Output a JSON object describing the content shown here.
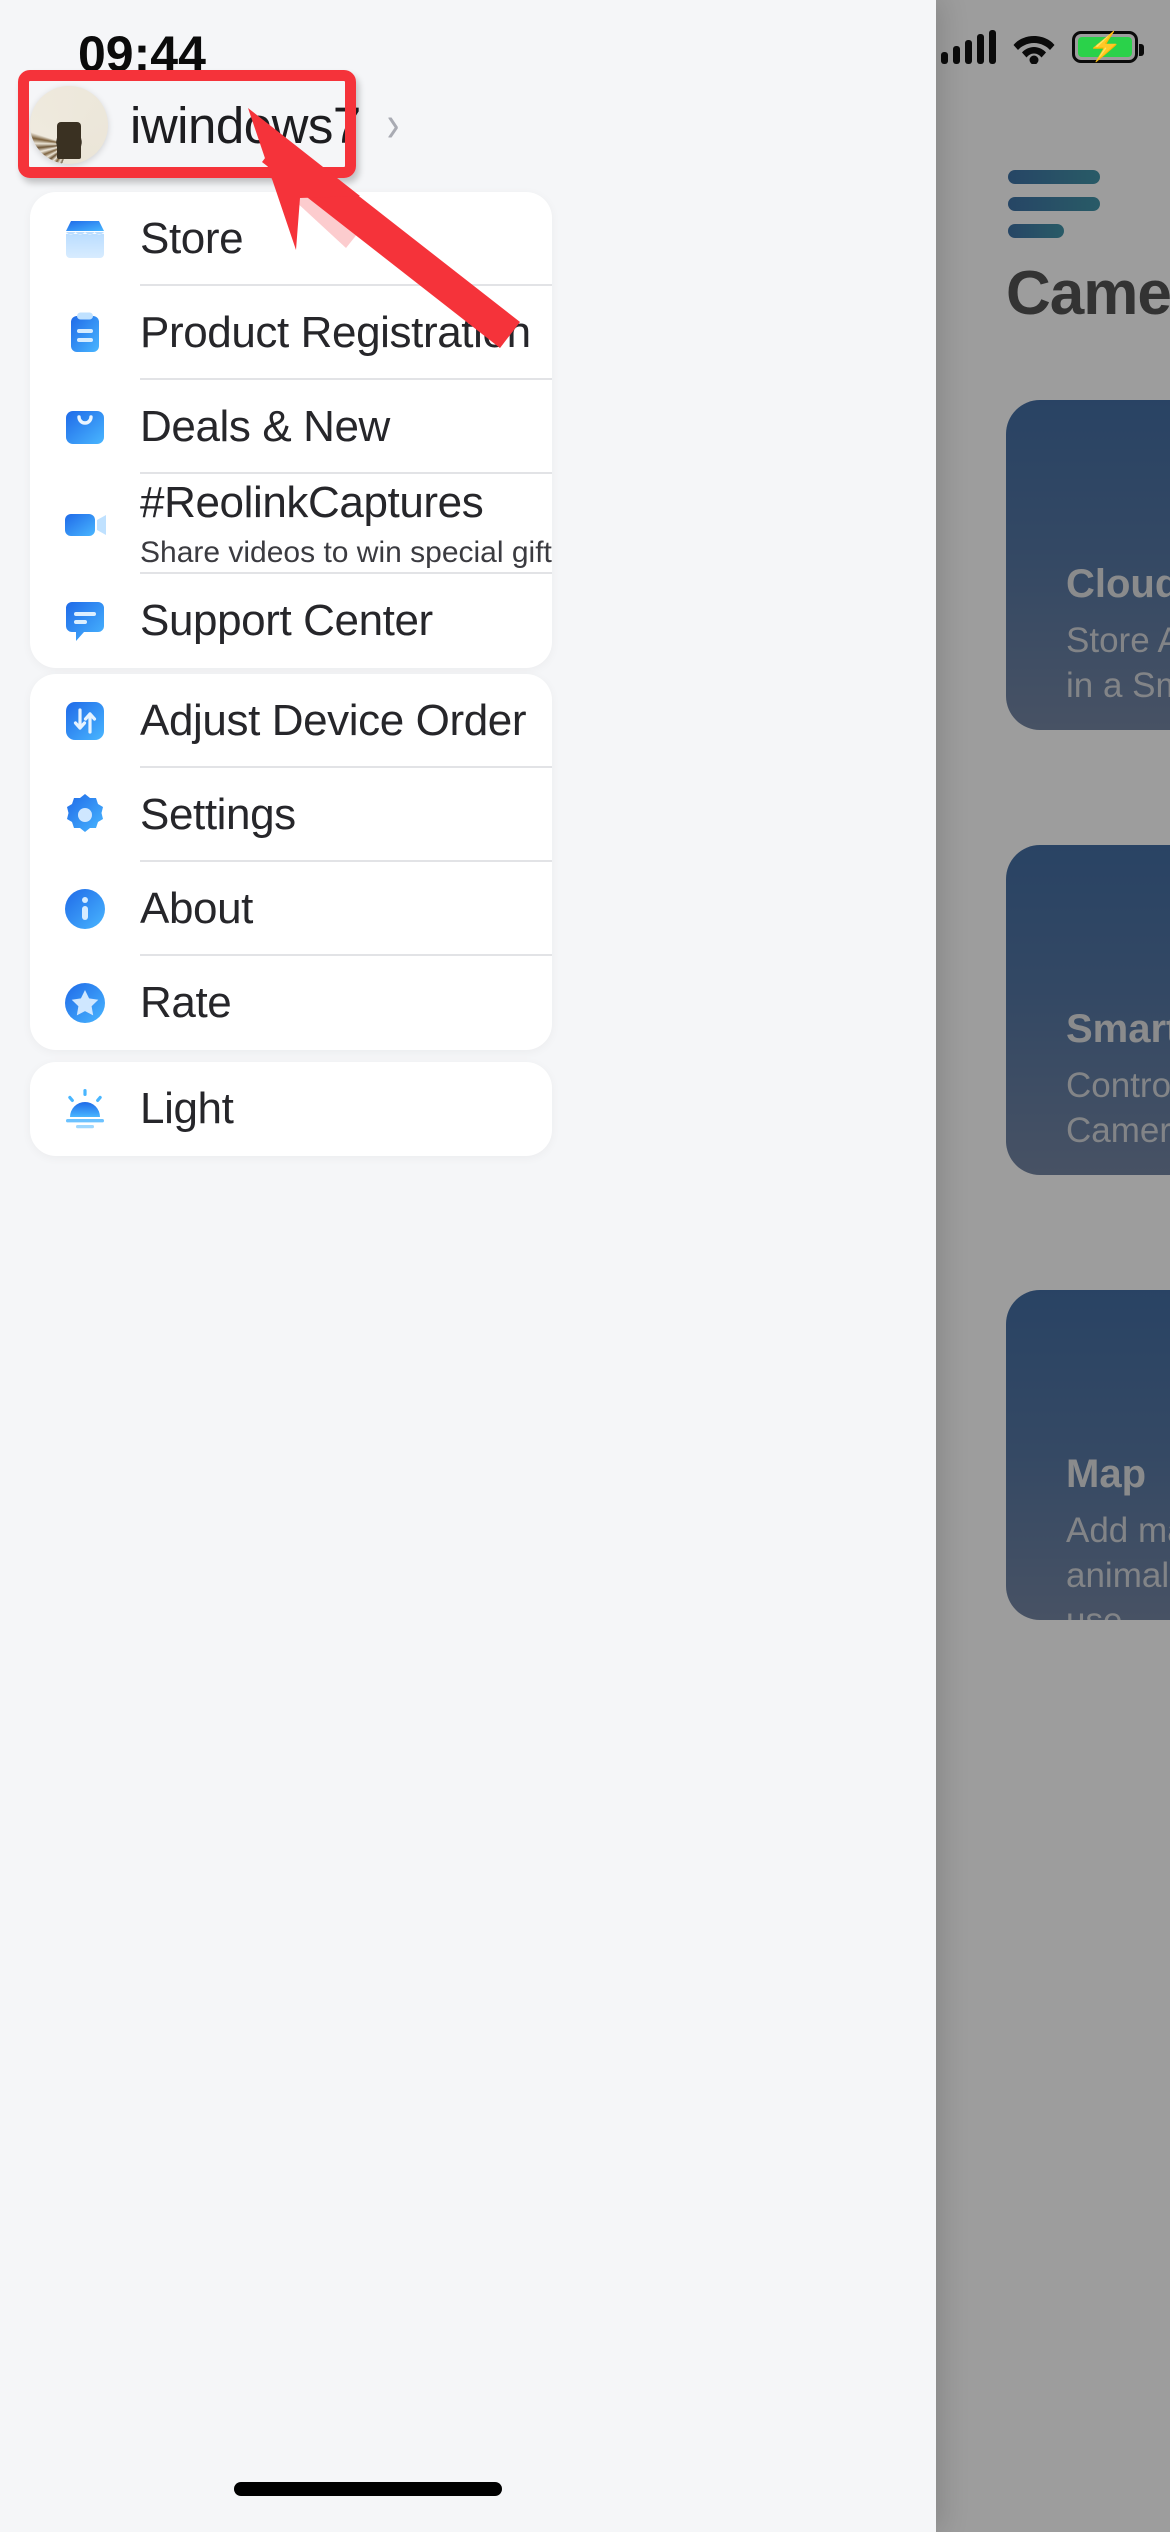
{
  "status_bar": {
    "time": "09:44",
    "signal_icon": "signal-bars-icon",
    "wifi_icon": "wifi-icon",
    "battery_icon": "battery-charging-icon"
  },
  "profile": {
    "name": "iwindows7",
    "avatar_icon": "avatar",
    "chevron": "›",
    "highlight_color": "#f5333a"
  },
  "menu_groups": [
    {
      "items": [
        {
          "label": "Store",
          "sub": "",
          "icon": "storefront-icon"
        },
        {
          "label": "Product Registration",
          "sub": "",
          "icon": "clipboard-icon"
        },
        {
          "label": "Deals & New",
          "sub": "",
          "icon": "shopping-bag-icon"
        },
        {
          "label": "#ReolinkCaptures",
          "sub": "Share videos to win special gifts.",
          "icon": "video-camera-icon"
        },
        {
          "label": "Support Center",
          "sub": "",
          "icon": "chat-bubble-icon"
        }
      ]
    },
    {
      "items": [
        {
          "label": "Adjust Device Order",
          "sub": "",
          "icon": "sort-arrows-icon"
        },
        {
          "label": "Settings",
          "sub": "",
          "icon": "gear-icon"
        },
        {
          "label": "About",
          "sub": "",
          "icon": "info-circle-icon"
        },
        {
          "label": "Rate",
          "sub": "",
          "icon": "star-circle-icon"
        }
      ]
    },
    {
      "items": [
        {
          "label": "Light",
          "sub": "",
          "icon": "sunrise-light-icon"
        }
      ]
    }
  ],
  "background_app": {
    "menu_icon": "hamburger-menu-icon",
    "title": "Camera",
    "cards": [
      {
        "title": "Cloud Storage",
        "sub": "Store All That Matter, in a Smarter Way"
      },
      {
        "title": "Smart Home",
        "sub": "Control Your Camera, Just Ask"
      },
      {
        "title": "Map",
        "sub": "Add markers for animal in your device use"
      }
    ]
  },
  "accent": {
    "icon_blue_dark": "#1f6ae8",
    "icon_blue_light": "#49b6ff",
    "highlight_red": "#f5333a",
    "brand_teal": "#167a92"
  }
}
